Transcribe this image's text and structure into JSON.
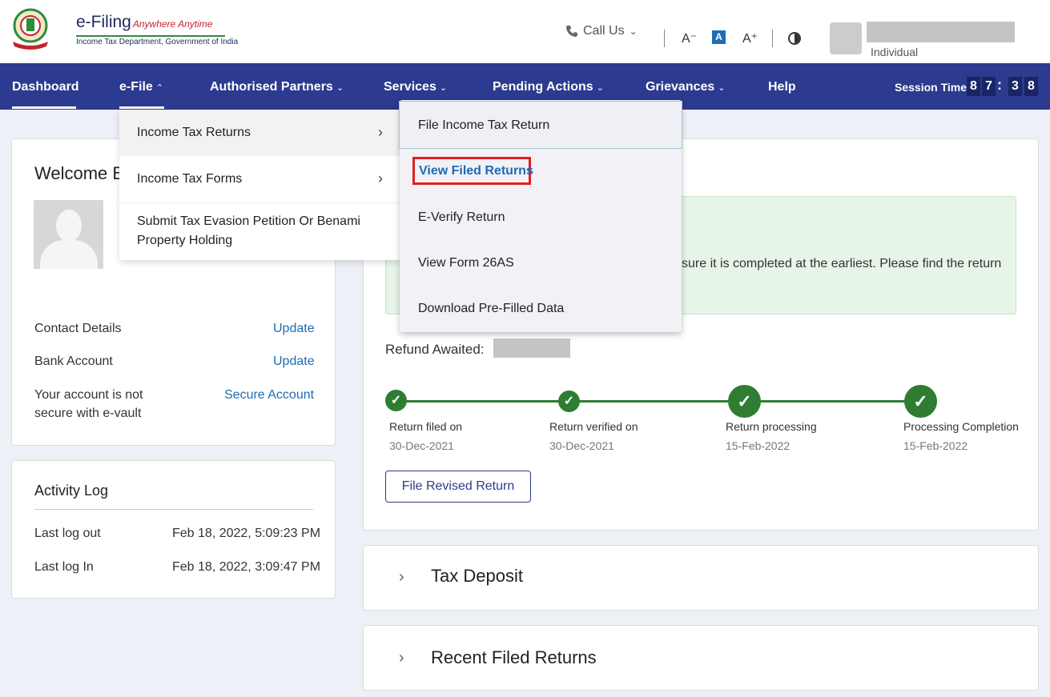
{
  "header": {
    "logo_title": "e-Filing",
    "logo_tagline": "Anywhere Anytime",
    "logo_subtitle": "Income Tax Department, Government of India",
    "call_us": "Call Us",
    "font_decrease": "A⁻",
    "font_normal": "A",
    "font_increase": "A⁺",
    "user_type": "Individual"
  },
  "nav": {
    "items": [
      {
        "label": "Dashboard"
      },
      {
        "label": "e-File"
      },
      {
        "label": "Authorised Partners"
      },
      {
        "label": "Services"
      },
      {
        "label": "Pending Actions"
      },
      {
        "label": "Grievances"
      },
      {
        "label": "Help"
      }
    ],
    "session_label": "Session Time",
    "session_digits": [
      "8",
      "7",
      "3",
      "8"
    ],
    "session_colon": ":"
  },
  "efile_menu": {
    "items": [
      {
        "label": "Income Tax Returns"
      },
      {
        "label": "Income Tax Forms"
      },
      {
        "label": "Submit Tax Evasion Petition Or Benami",
        "label2": "Property Holding"
      }
    ]
  },
  "itr_submenu": {
    "items": [
      {
        "label": "File Income Tax Return"
      },
      {
        "label": "View Filed Returns"
      },
      {
        "label": "E-Verify Return"
      },
      {
        "label": "View Form 26AS"
      },
      {
        "label": "Download Pre-Filled Data"
      }
    ]
  },
  "welcome": {
    "title": "Welcome B",
    "contact_label": "Contact Details",
    "contact_action": "Update",
    "bank_label": "Bank Account",
    "bank_action": "Update",
    "vault_label_1": "Your account is not",
    "vault_label_2": "secure with e-vault",
    "vault_action": "Secure Account"
  },
  "activity": {
    "title": "Activity Log",
    "rows": [
      {
        "label": "Last log out",
        "value": "Feb 18, 2022, 5:09:23 PM"
      },
      {
        "label": "Last log In",
        "value": "Feb 18, 2022, 3:09:47 PM"
      }
    ]
  },
  "status": {
    "notice_line1": "sure it is completed at the earliest. Please find the return",
    "refund_label": "Refund Awaited:",
    "steps": [
      {
        "label": "Return filed on",
        "date": "30-Dec-2021"
      },
      {
        "label": "Return verified on",
        "date": "30-Dec-2021"
      },
      {
        "label": "Return processing",
        "date": "15-Feb-2022"
      },
      {
        "label": "Processing Completion",
        "date": "15-Feb-2022"
      }
    ],
    "revise_button": "File Revised Return"
  },
  "accordions": {
    "tax_deposit": "Tax Deposit",
    "recent_returns": "Recent Filed Returns"
  },
  "colors": {
    "nav_bg": "#2c3a8f",
    "link": "#1f6bb4",
    "success": "#2e7d32",
    "highlight_box": "#e02020"
  }
}
